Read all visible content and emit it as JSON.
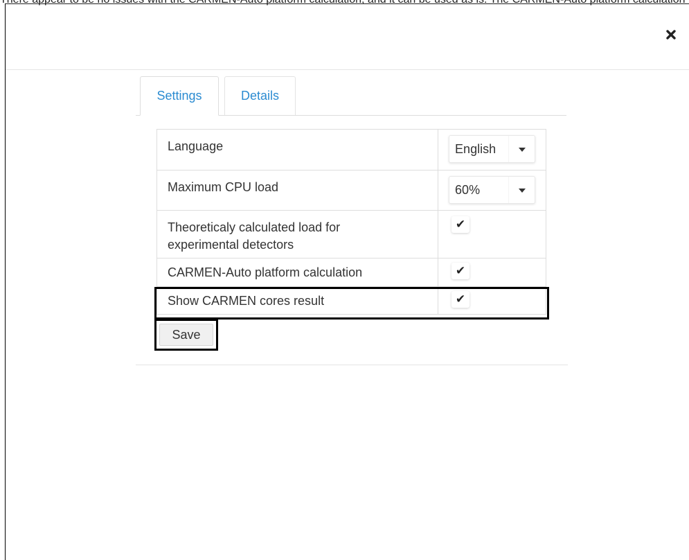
{
  "top_text": "There appear to be no issues with the CARMEN-Auto platform calculation, and it can be used as is. The CARMEN-Auto platform calculation is carried out",
  "close_icon": "close-icon",
  "tabs": [
    {
      "label": "Settings",
      "active": true
    },
    {
      "label": "Details",
      "active": false
    }
  ],
  "settings": {
    "language": {
      "label": "Language",
      "value": "English"
    },
    "cpu": {
      "label": "Maximum CPU load",
      "value": "60%"
    },
    "theoretical": {
      "label_line1": "Theoreticaly calculated load for",
      "label_line2": "experimental detectors",
      "checked": true
    },
    "carmen_auto": {
      "label": "CARMEN-Auto platform calculation",
      "checked": true
    },
    "carmen_cores": {
      "label": "Show CARMEN cores result",
      "checked": true
    }
  },
  "checkmark": "✔",
  "save_label": "Save",
  "colors": {
    "link": "#2b8bd1",
    "border": "#dddddd",
    "highlight": "#000000"
  }
}
